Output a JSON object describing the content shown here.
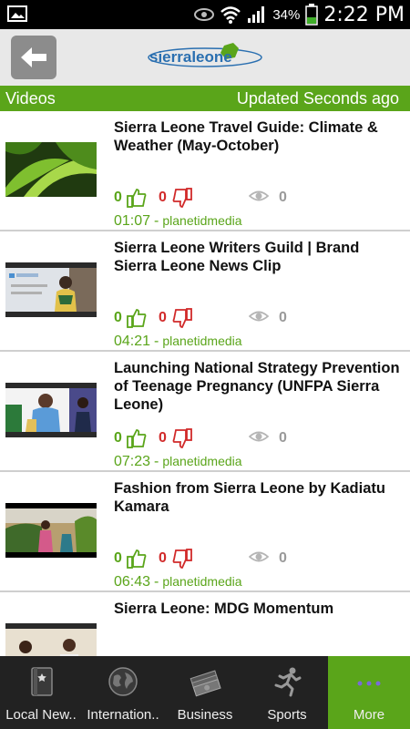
{
  "status_bar": {
    "battery_percent": "34%",
    "time": "2:22 PM"
  },
  "header": {
    "logo_text": "sierraleone"
  },
  "section": {
    "title": "Videos",
    "updated": "Updated Seconds ago"
  },
  "videos": [
    {
      "title": "Sierra Leone Travel Guide: Climate & Weather (May-October)",
      "likes": "0",
      "dislikes": "0",
      "views": "0",
      "duration": "01:07",
      "dash": "-",
      "channel": "planetidmedia"
    },
    {
      "title": "Sierra Leone Writers Guild | Brand Sierra Leone News Clip",
      "likes": "0",
      "dislikes": "0",
      "views": "0",
      "duration": "04:21",
      "dash": "-",
      "channel": "planetidmedia"
    },
    {
      "title": "Launching National Strategy Prevention of Teenage Pregnancy (UNFPA Sierra Leone)",
      "likes": "0",
      "dislikes": "0",
      "views": "0",
      "duration": "07:23",
      "dash": "-",
      "channel": "planetidmedia"
    },
    {
      "title": "Fashion from Sierra Leone by Kadiatu Kamara",
      "likes": "0",
      "dislikes": "0",
      "views": "0",
      "duration": "06:43",
      "dash": "-",
      "channel": "planetidmedia"
    },
    {
      "title": "Sierra Leone: MDG Momentum",
      "likes": "",
      "dislikes": "",
      "views": "",
      "duration": "",
      "dash": "",
      "channel": ""
    }
  ],
  "bottom_nav": {
    "tabs": [
      {
        "label": "Local New..",
        "icon": "book-icon"
      },
      {
        "label": "Internation..",
        "icon": "globe-icon"
      },
      {
        "label": "Business",
        "icon": "money-icon"
      },
      {
        "label": "Sports",
        "icon": "runner-icon"
      },
      {
        "label": "More",
        "icon": "more-icon",
        "active": true
      }
    ]
  },
  "colors": {
    "accent_green": "#5aa51a",
    "dislike_red": "#d12a2a",
    "logo_blue": "#2a6fb0"
  }
}
